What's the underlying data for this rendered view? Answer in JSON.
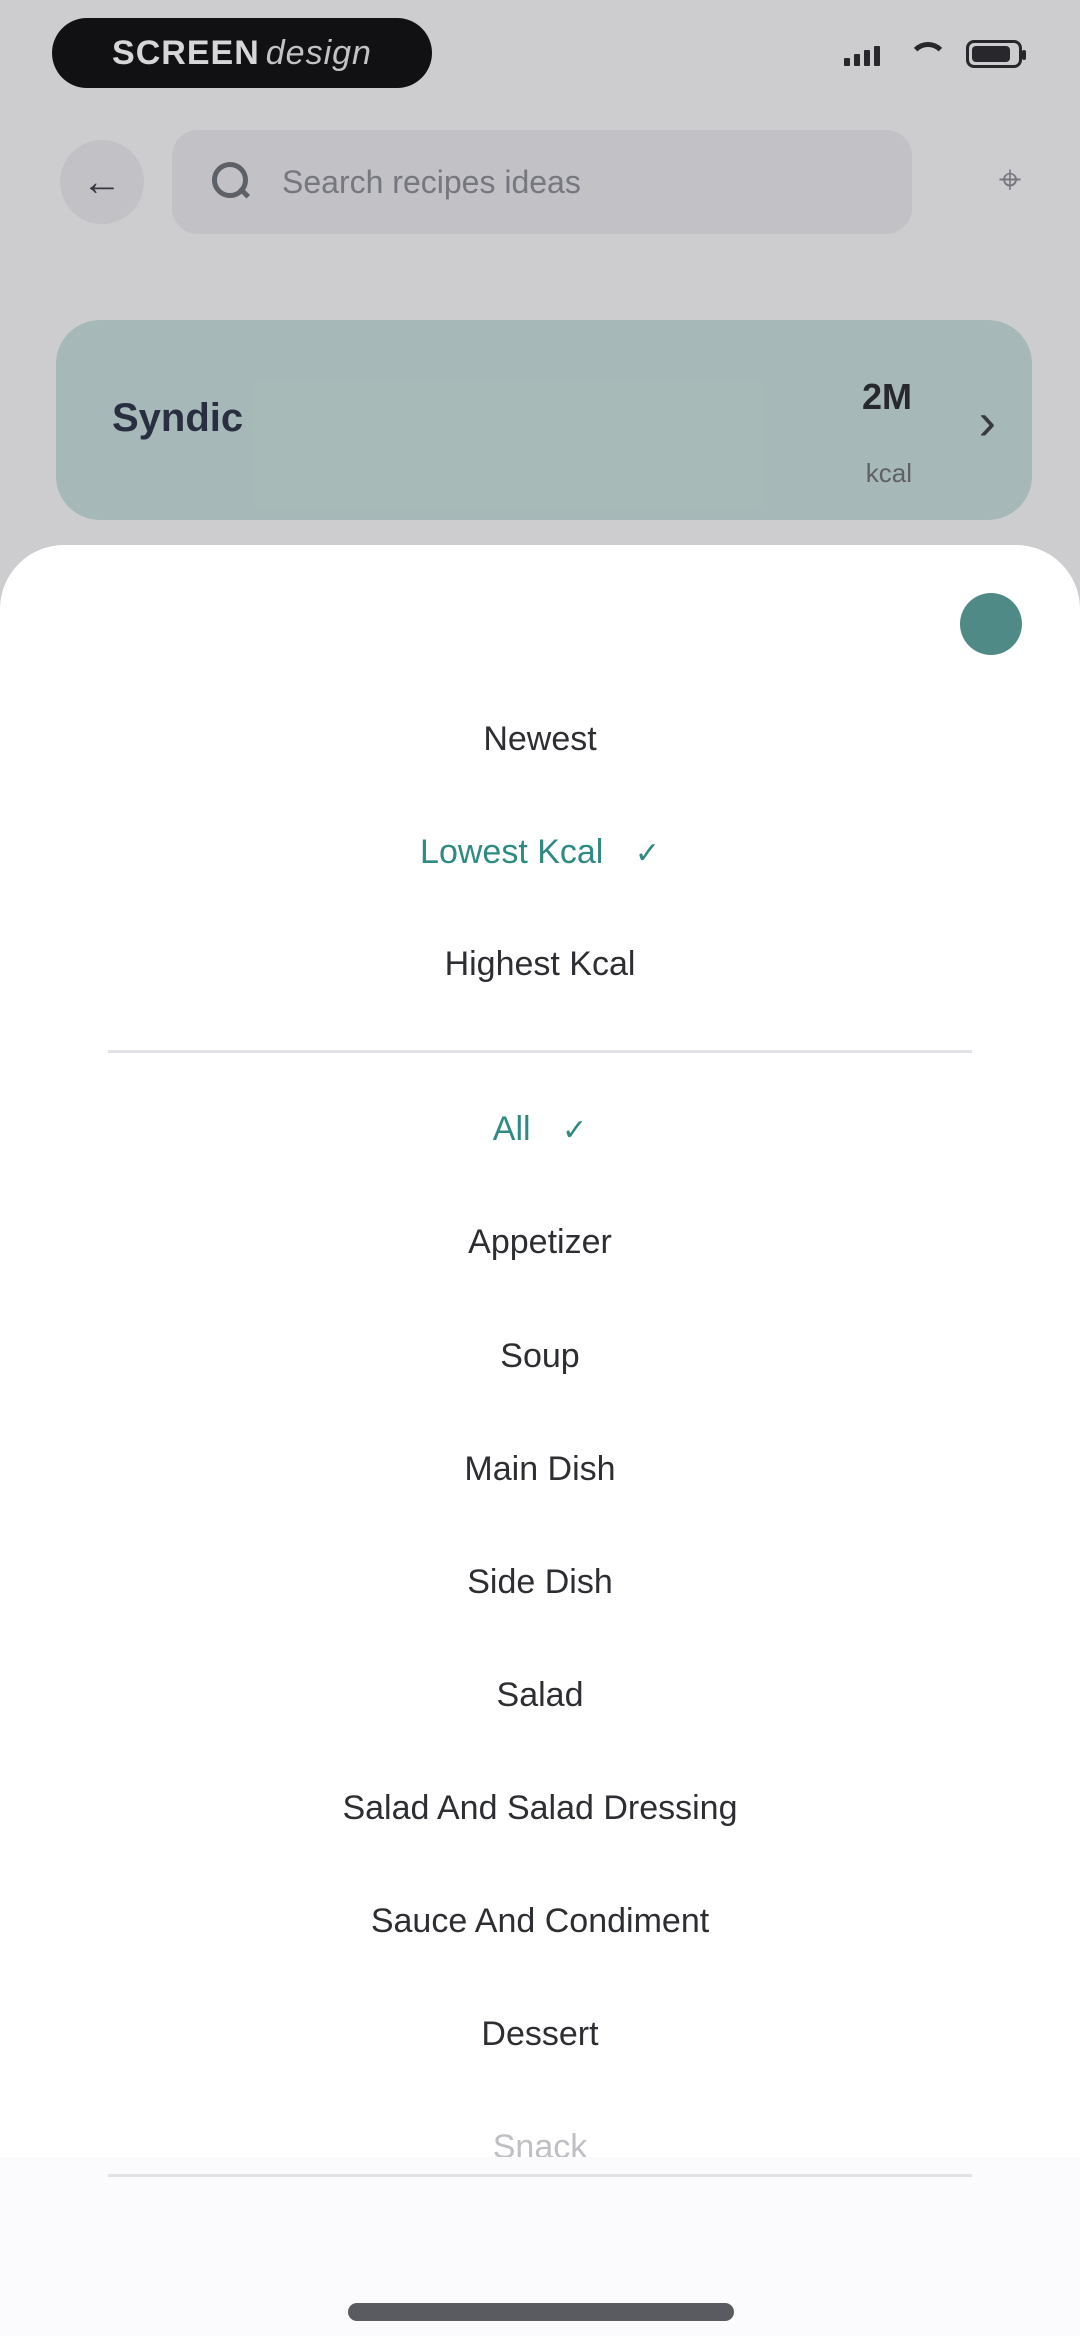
{
  "status_bar": {
    "recording_brand": "SCREEN",
    "recording_sub": "design",
    "icons": [
      "signal-icon",
      "wifi-icon",
      "battery-icon"
    ]
  },
  "header": {
    "search_placeholder": "Search recipes ideas",
    "icons": [
      "back-icon",
      "search-icon",
      "filter-icon"
    ]
  },
  "category_card": {
    "name": "Syndic",
    "count": "2M",
    "unit": "kcal",
    "background": "#c5dcd8"
  },
  "sort_options": [
    {
      "label": "Newest",
      "selected": false
    },
    {
      "label": "Lowest Kcal",
      "selected": true
    },
    {
      "label": "Highest Kcal",
      "selected": false
    }
  ],
  "category_options": [
    {
      "label": "All",
      "selected": true
    },
    {
      "label": "Appetizer",
      "selected": false
    },
    {
      "label": "Soup",
      "selected": false
    },
    {
      "label": "Main Dish",
      "selected": false
    },
    {
      "label": "Side Dish",
      "selected": false
    },
    {
      "label": "Salad",
      "selected": false
    },
    {
      "label": "Salad And Salad Dressing",
      "selected": false
    },
    {
      "label": "Sauce And Condiment",
      "selected": false
    },
    {
      "label": "Dessert",
      "selected": false
    },
    {
      "label": "Snack",
      "selected": false
    }
  ],
  "check_symbol": "✓",
  "accent_color": "#2f8a82"
}
